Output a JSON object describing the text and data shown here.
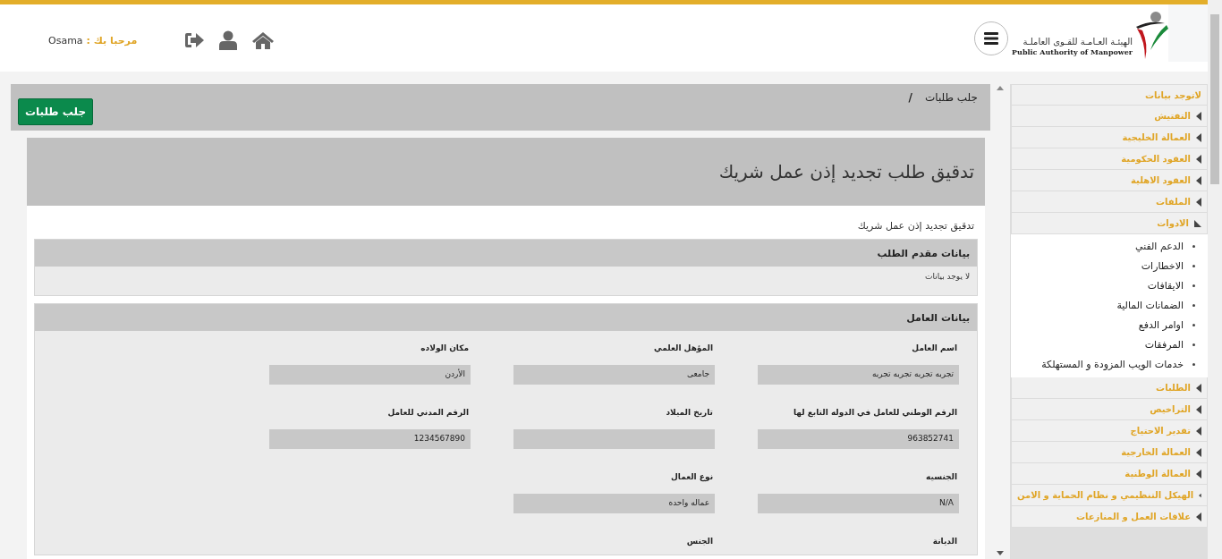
{
  "header": {
    "logo_arabic": "الهيئـة العـامـة للقـوى العاملـة",
    "logo_english": "Public Authority of Manpower",
    "greeting": "مرحبا بك :",
    "user": "Osama"
  },
  "toolbar": {
    "breadcrumb": "جلب طلبات",
    "separator": "/",
    "button": "جلب طلبات"
  },
  "page": {
    "title": "تدقيق طلب تجديد إذن عمل شريك",
    "subtitle": "تدقيق تجديد إذن عمل شريك",
    "applicant": {
      "title": "بيانات مقدم الطلب",
      "message": "لا يوجد بيانات"
    },
    "worker": {
      "title": "بيانات العامل",
      "rows": [
        [
          {
            "kind": "input",
            "label": "اسم العامل",
            "value": "تجربه تجربه تجربه تجربه"
          },
          {
            "kind": "input",
            "label": "المؤهل العلمي",
            "value": "جامعى"
          },
          {
            "kind": "input",
            "label": "مكان الولاده",
            "value": "الأردن"
          }
        ],
        [
          {
            "kind": "input",
            "label": "الرقم الوطني للعامل في الدوله التابع لها",
            "value": "963852741"
          },
          {
            "kind": "input",
            "label": "تاريخ الميلاد"
          },
          {
            "kind": "input",
            "label": "الرقم المدني للعامل",
            "value": "1234567890"
          }
        ],
        [
          {
            "kind": "input",
            "label": "الجنسيه",
            "value": "N/A"
          },
          {
            "kind": "input",
            "label": "نوع العمال",
            "value": "عماله واحده"
          }
        ],
        [
          {
            "kind": "label",
            "label": "الديانة"
          },
          {
            "kind": "label",
            "label": "الجنس"
          }
        ]
      ]
    }
  },
  "sidebar": {
    "items": [
      {
        "kind": "plain",
        "label": "لاتوجد بيانات"
      },
      {
        "kind": "group",
        "label": "التفتيش",
        "expanded": false
      },
      {
        "kind": "group",
        "label": "العمالة الخليجية",
        "expanded": false
      },
      {
        "kind": "group",
        "label": "العقود الحكومية",
        "expanded": false
      },
      {
        "kind": "group",
        "label": "العقود الاهلية",
        "expanded": false
      },
      {
        "kind": "group",
        "label": "الملفات",
        "expanded": false
      },
      {
        "kind": "group",
        "label": "الادوات",
        "expanded": true,
        "children": [
          "الدعم الفني",
          "الاخطارات",
          "الايقافات",
          "الضمانات المالية",
          "اوامر الدفع",
          "المرفقات",
          "خدمات الويب المزودة و المستهلكة"
        ]
      },
      {
        "kind": "group",
        "label": "الطلبات",
        "expanded": false
      },
      {
        "kind": "group",
        "label": "التراخيص",
        "expanded": false
      },
      {
        "kind": "group",
        "label": "تقدير الاحتياج",
        "expanded": false
      },
      {
        "kind": "group",
        "label": "العمالة الخارجية",
        "expanded": false
      },
      {
        "kind": "group",
        "label": "العمالة الوطنية",
        "expanded": false
      },
      {
        "kind": "group",
        "label": "الهيكل التنظيمي و نظام الحماية و الامن",
        "expanded": false
      },
      {
        "kind": "group",
        "label": "علاقات العمل و المنازعات",
        "expanded": false
      }
    ]
  }
}
